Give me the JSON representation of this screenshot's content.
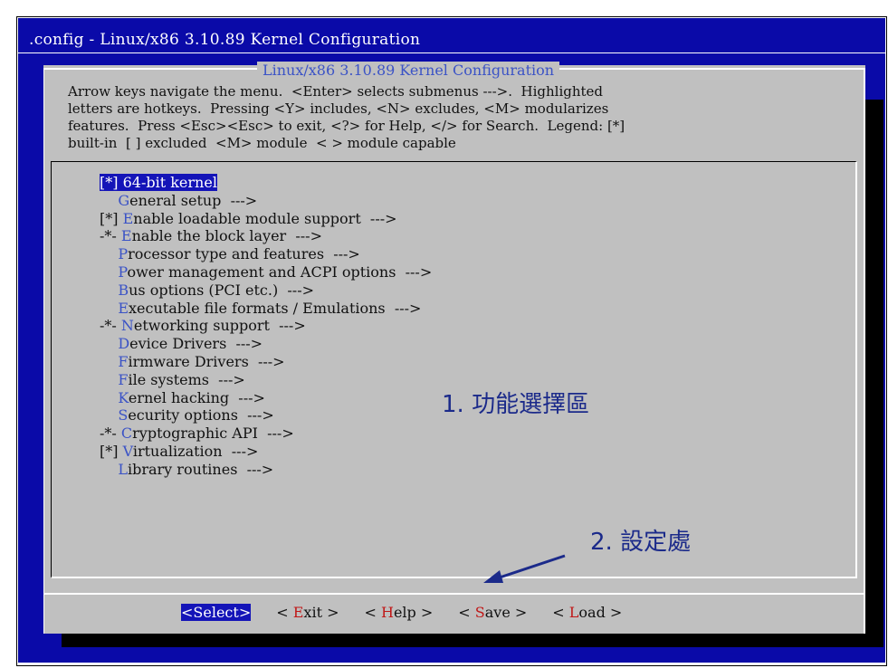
{
  "window": {
    "title": ".config - Linux/x86 3.10.89 Kernel Configuration"
  },
  "dialog": {
    "title": "Linux/x86 3.10.89 Kernel Configuration",
    "help_lines": [
      "Arrow keys navigate the menu.  <Enter> selects submenus --->.  Highlighted",
      "letters are hotkeys.  Pressing <Y> includes, <N> excludes, <M> modularizes",
      "features.  Press <Esc><Esc> to exit, <?> for Help, </> for Search.  Legend: [*]",
      "built-in  [ ] excluded  <M> module  < > module capable"
    ]
  },
  "menu": {
    "items": [
      {
        "prefix": "[*] ",
        "hotkey": "6",
        "rest": "4-bit kernel",
        "selected": true
      },
      {
        "prefix": "    ",
        "hotkey": "G",
        "rest": "eneral setup  --->"
      },
      {
        "prefix": "[*] ",
        "hotkey": "E",
        "rest": "nable loadable module support  --->"
      },
      {
        "prefix": "-*- ",
        "hotkey": "E",
        "rest": "nable the block layer  --->"
      },
      {
        "prefix": "    ",
        "hotkey": "P",
        "rest": "rocessor type and features  --->"
      },
      {
        "prefix": "    ",
        "hotkey": "P",
        "rest": "ower management and ACPI options  --->"
      },
      {
        "prefix": "    ",
        "hotkey": "B",
        "rest": "us options (PCI etc.)  --->"
      },
      {
        "prefix": "    ",
        "hotkey": "E",
        "rest": "xecutable file formats / Emulations  --->"
      },
      {
        "prefix": "-*- ",
        "hotkey": "N",
        "rest": "etworking support  --->"
      },
      {
        "prefix": "    ",
        "hotkey": "D",
        "rest": "evice Drivers  --->"
      },
      {
        "prefix": "    ",
        "hotkey": "F",
        "rest": "irmware Drivers  --->"
      },
      {
        "prefix": "    ",
        "hotkey": "F",
        "rest": "ile systems  --->"
      },
      {
        "prefix": "    ",
        "hotkey": "K",
        "rest": "ernel hacking  --->"
      },
      {
        "prefix": "    ",
        "hotkey": "S",
        "rest": "ecurity options  --->"
      },
      {
        "prefix": "-*- ",
        "hotkey": "C",
        "rest": "ryptographic API  --->"
      },
      {
        "prefix": "[*] ",
        "hotkey": "V",
        "rest": "irtualization  --->"
      },
      {
        "prefix": "    ",
        "hotkey": "L",
        "rest": "ibrary routines  --->"
      }
    ]
  },
  "buttons": {
    "select": {
      "open": "<",
      "hotkey": "S",
      "rest": "elect",
      "close": ">"
    },
    "exit": {
      "open": "< ",
      "hotkey": "E",
      "rest": "xit",
      "close": " >"
    },
    "help": {
      "open": "< ",
      "hotkey": "H",
      "rest": "elp",
      "close": " >"
    },
    "save": {
      "open": "< ",
      "hotkey": "S",
      "rest": "ave",
      "close": " >"
    },
    "load": {
      "open": "< ",
      "hotkey": "L",
      "rest": "oad",
      "close": " >"
    }
  },
  "annotations": {
    "area1": "1. 功能選擇區",
    "area2": "2. 設定處"
  },
  "colors": {
    "terminal_bg": "#0a0aa8",
    "dialog_bg": "#c0c0c0",
    "hotkey_blue": "#3b53c6",
    "hotkey_red": "#c01818",
    "highlight": "#1414b8",
    "annotation": "#1b2a8a"
  }
}
